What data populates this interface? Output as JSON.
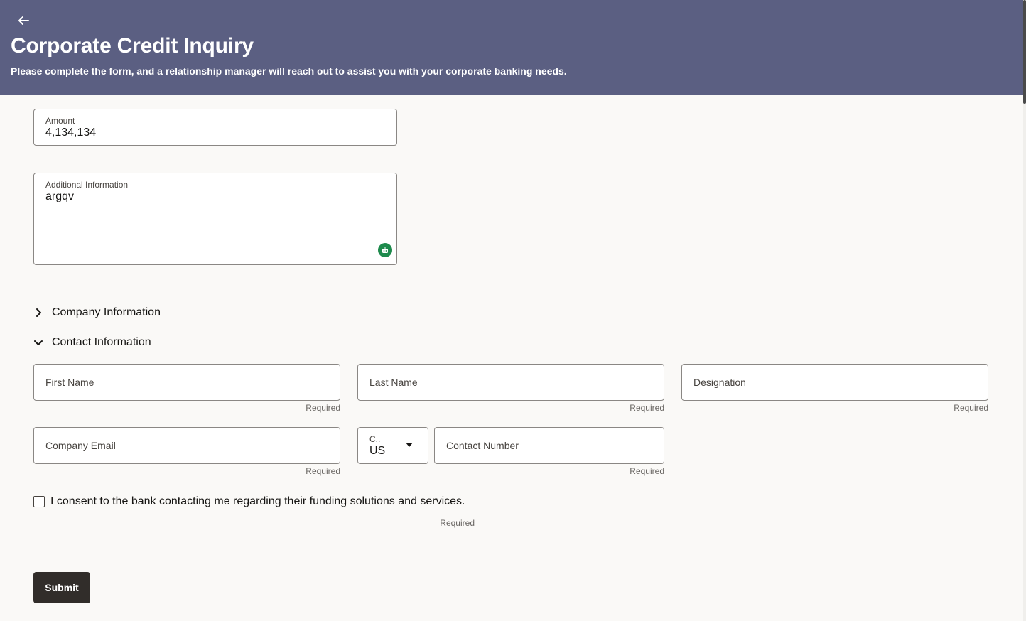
{
  "header": {
    "title": "Corporate Credit Inquiry",
    "subtitle": "Please complete the form, and a relationship manager will reach out to assist you with your corporate banking needs.",
    "back_icon": "arrow-left-icon",
    "background_color": "#5b5f82"
  },
  "amount": {
    "label": "Amount",
    "value": "4,134,134"
  },
  "additional_info": {
    "label": "Additional Information",
    "value": "argqv",
    "assist_icon": "ai-assistant-icon"
  },
  "sections": {
    "company": {
      "label": "Company Information",
      "expanded": false
    },
    "contact": {
      "label": "Contact Information",
      "expanded": true
    }
  },
  "contact_fields": {
    "first_name": {
      "placeholder": "First Name",
      "helper": "Required"
    },
    "last_name": {
      "placeholder": "Last Name",
      "helper": "Required"
    },
    "designation": {
      "placeholder": "Designation",
      "helper": "Required"
    },
    "company_email": {
      "placeholder": "Company Email",
      "helper": "Required"
    },
    "country_code": {
      "label": "C..",
      "value": "US"
    },
    "contact_number": {
      "placeholder": "Contact Number",
      "helper": "Required"
    }
  },
  "consent": {
    "label": "I consent to the bank contacting me regarding their funding solutions and services.",
    "helper": "Required",
    "checked": false
  },
  "submit_label": "Submit",
  "colors": {
    "primary_button": "#312d2a",
    "ai_icon": "#1d8a4c"
  }
}
